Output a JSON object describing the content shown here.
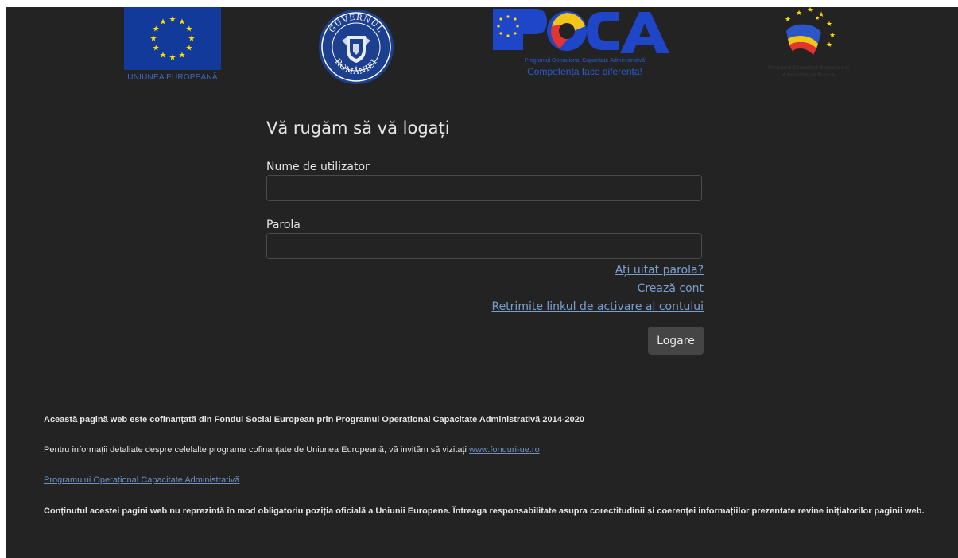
{
  "logos": {
    "eu_caption": "UNIUNEA EUROPEANĂ",
    "gov_seal_top": "GUVERNUL",
    "gov_seal_bottom": "ROMÂNIEI",
    "poca_subtitle": "Programul Operațional Capacitate Administrativă",
    "poca_tagline": "Competența face diferența!",
    "mdrap_caption": "Ministerul Dezvoltării Regionale și Administrației Publice"
  },
  "login": {
    "title": "Vă rugăm să vă logați",
    "username_label": "Nume de utilizator",
    "username_value": "",
    "password_label": "Parola",
    "password_value": "",
    "forgot_password": "Ați uitat parola?",
    "create_account": "Crează cont",
    "resend_activation": "Retrimite linkul de activare al contului",
    "submit": "Logare"
  },
  "footer": {
    "cofinanced": "Această pagină web este cofinanțată din Fondul Social European prin Programul Operațional Capacitate Administrativă 2014-2020",
    "info_text": "Pentru informații detaliate despre celelalte programe cofinanțate de Uniunea Europeană, vă invităm să vizitați",
    "info_link": "www.fonduri-ue.ro",
    "program_link": "Programului Operațional Capacitate Administrativă",
    "disclaimer": "Conținutul acestei pagini web nu reprezintă în mod obligatoriu poziția oficială a Uniunii Europene. Întreaga responsabilitate asupra corectitudinii și coerenței informațiilor prezentate revine inițiatorilor paginii web."
  },
  "colors": {
    "background": "#232323",
    "eu_blue": "#113a9a",
    "eu_star": "#ffdd00",
    "link": "#7a9fcf",
    "button": "#454545"
  }
}
